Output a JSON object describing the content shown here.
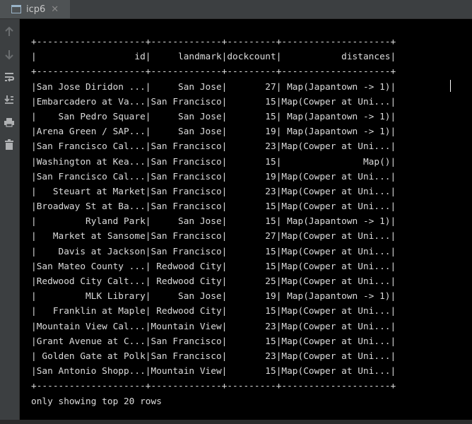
{
  "tab": {
    "label": "icp6"
  },
  "toolbar": {
    "icons": [
      "up-arrow-icon",
      "down-arrow-icon",
      "soft-wrap-icon",
      "scroll-to-end-icon",
      "print-icon",
      "trash-icon"
    ]
  },
  "console": {
    "lines": [
      "+--------------------+-------------+---------+--------------------+",
      "|                  id|     landmark|dockcount|           distances|",
      "+--------------------+-------------+---------+--------------------+",
      "|San Jose Diridon ...|     San Jose|       27| Map(Japantown -> 1)|",
      "|Embarcadero at Va...|San Francisco|       15|Map(Cowper at Uni...|",
      "|    San Pedro Square|     San Jose|       15| Map(Japantown -> 1)|",
      "|Arena Green / SAP...|     San Jose|       19| Map(Japantown -> 1)|",
      "|San Francisco Cal...|San Francisco|       23|Map(Cowper at Uni...|",
      "|Washington at Kea...|San Francisco|       15|               Map()|",
      "|San Francisco Cal...|San Francisco|       19|Map(Cowper at Uni...|",
      "|   Steuart at Market|San Francisco|       23|Map(Cowper at Uni...|",
      "|Broadway St at Ba...|San Francisco|       15|Map(Cowper at Uni...|",
      "|         Ryland Park|     San Jose|       15| Map(Japantown -> 1)|",
      "|   Market at Sansome|San Francisco|       27|Map(Cowper at Uni...|",
      "|    Davis at Jackson|San Francisco|       15|Map(Cowper at Uni...|",
      "|San Mateo County ...| Redwood City|       15|Map(Cowper at Uni...|",
      "|Redwood City Calt...| Redwood City|       25|Map(Cowper at Uni...|",
      "|         MLK Library|     San Jose|       19| Map(Japantown -> 1)|",
      "|   Franklin at Maple| Redwood City|       15|Map(Cowper at Uni...|",
      "|Mountain View Cal...|Mountain View|       23|Map(Cowper at Uni...|",
      "|Grant Avenue at C...|San Francisco|       15|Map(Cowper at Uni...|",
      "| Golden Gate at Polk|San Francisco|       23|Map(Cowper at Uni...|",
      "|San Antonio Shopp...|Mountain View|       15|Map(Cowper at Uni...|",
      "+--------------------+-------------+---------+--------------------+",
      "only showing top 20 rows"
    ]
  }
}
